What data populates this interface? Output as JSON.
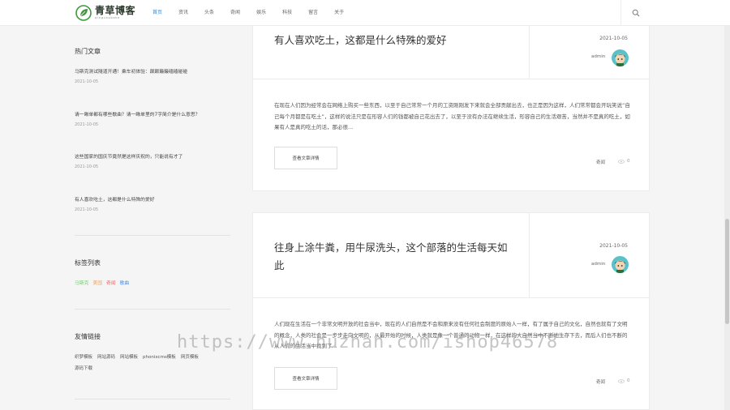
{
  "header": {
    "logo_title": "青草博客",
    "logo_sub": "qingcaoboke",
    "nav": [
      {
        "label": "首页",
        "active": true
      },
      {
        "label": "资讯",
        "active": false
      },
      {
        "label": "头条",
        "active": false
      },
      {
        "label": "奇闻",
        "active": false
      },
      {
        "label": "娱乐",
        "active": false
      },
      {
        "label": "科技",
        "active": false
      },
      {
        "label": "留言",
        "active": false
      },
      {
        "label": "关于",
        "active": false
      }
    ],
    "search_icon": "search-icon"
  },
  "sidebar": {
    "hot_title": "热门文章",
    "hot_articles": [
      {
        "title": "马斯克测试隧道开通！乘车初体验：颠颠簸簸磕磕碰碰",
        "date": "2021-10-05"
      },
      {
        "title": "请一瞅单都有哪些歇曲？请一瞅单里的7字简介是什么意思？",
        "date": "2021-10-05"
      },
      {
        "title": "这些国家的国庆节竟然是这样庆祝的，只能说有才了",
        "date": "2021-10-05"
      },
      {
        "title": "有人喜欢吃土，这都是什么特殊的爱好",
        "date": "2021-10-05"
      }
    ],
    "tags_title": "标签列表",
    "tags": [
      {
        "label": "马斯克",
        "color": "#7cc576"
      },
      {
        "label": "美国",
        "color": "#f0a35e"
      },
      {
        "label": "奇闻",
        "color": "#e86a6a"
      },
      {
        "label": "歌曲",
        "color": "#4f8fe0"
      }
    ],
    "links_title": "友情链接",
    "links": [
      "织梦模板",
      "网站源码",
      "网站模板",
      "phonixcms模板",
      "网页模板",
      "源码下载"
    ]
  },
  "posts": [
    {
      "title": "有人喜欢吃土，这都是什么特殊的爱好",
      "date": "2021-10-05",
      "author": "admin",
      "excerpt": "在现在人们因为经常会在网络上购买一些东西，以至于自己常常一个月的工资刚刚发下来就会全部贡献出去，也正是因为这样，人们常常都会开玩笑说“自己每个月都是在吃土”，这样的说法只是在形容人们的钱都被自己花出去了，以至于没有办法在继续生活，形容自己的生活艰苦，当然并不是真的吃土，如果有人是真的吃土的话，那必很...",
      "read_label": "查看文章详情",
      "category": "奇闻",
      "views": "0"
    },
    {
      "title": "往身上涂牛粪，用牛尿洗头，这个部落的生活每天如此",
      "date": "2021-10-05",
      "author": "admin",
      "excerpt": "人们现在生活在一个非常文明开放的社会当中，现在的人们自然是不会和原来没有任何社会制度的原始人一样，有了属于自己的文化，自然也就有了文明的概念，人类的社会是一步步走向文明的，从最开始的时候，人类就是像一个普通的动物一样，在这样的大自然当中不断地生存下去，而后人们也不断的从人们的生活当中找到了...",
      "read_label": "查看文章详情",
      "category": "奇闻",
      "views": "0"
    }
  ],
  "watermark": "https://www.huzhan.com/ishop46578"
}
